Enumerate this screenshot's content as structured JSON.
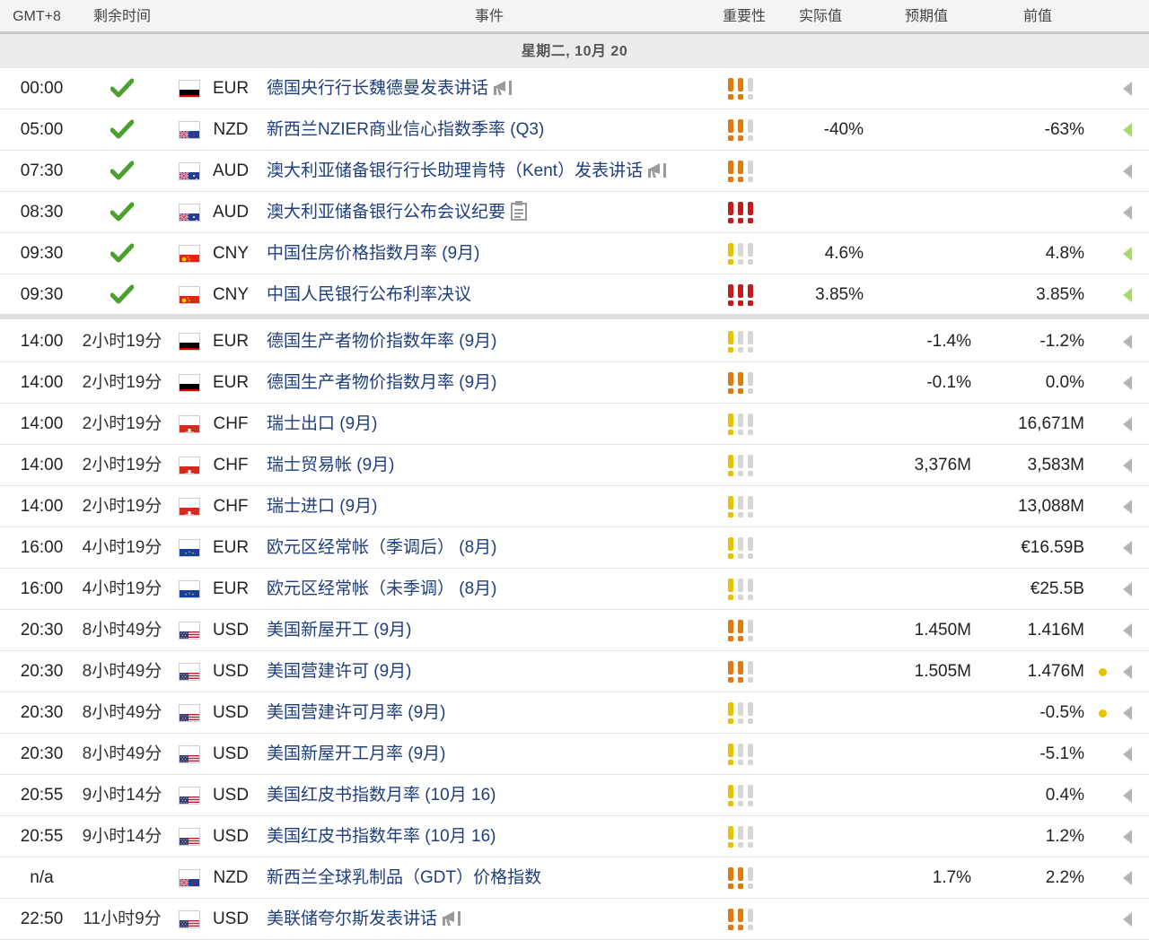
{
  "header": {
    "timezone": "GMT+8",
    "remaining": "剩余时间",
    "event": "事件",
    "importance": "重要性",
    "actual": "实际值",
    "forecast": "预期值",
    "previous": "前值"
  },
  "day_label": "星期二, 10月 20",
  "colors": {
    "check": "#4ca02f",
    "imp_orange": "#e07a10",
    "imp_red": "#c41c1c",
    "imp_yellow": "#e6c200",
    "imp_off": "#d6d6d6",
    "arrow_grey": "#b5b5b5",
    "arrow_green": "#a8d873",
    "event_text": "#1f3e7c"
  },
  "rows": [
    {
      "time": "00:00",
      "remaining": "",
      "done": true,
      "flag": "de",
      "currency": "EUR",
      "event": "德国央行行长魏德曼发表讲话",
      "icon": "speech-icon",
      "importance": 2,
      "actual": "",
      "forecast": "",
      "previous": "",
      "dot": false,
      "arrow": "grey"
    },
    {
      "time": "05:00",
      "remaining": "",
      "done": true,
      "flag": "nz",
      "currency": "NZD",
      "event": "新西兰NZIER商业信心指数季率 (Q3)",
      "icon": "",
      "importance": 2,
      "actual": "-40%",
      "forecast": "",
      "previous": "-63%",
      "dot": false,
      "arrow": "green"
    },
    {
      "time": "07:30",
      "remaining": "",
      "done": true,
      "flag": "au",
      "currency": "AUD",
      "event": "澳大利亚储备银行行长助理肯特（Kent）发表讲话",
      "icon": "speech-icon",
      "importance": 2,
      "actual": "",
      "forecast": "",
      "previous": "",
      "dot": false,
      "arrow": "grey"
    },
    {
      "time": "08:30",
      "remaining": "",
      "done": true,
      "flag": "au",
      "currency": "AUD",
      "event": "澳大利亚储备银行公布会议纪要",
      "icon": "report-icon",
      "importance": 3,
      "actual": "",
      "forecast": "",
      "previous": "",
      "dot": false,
      "arrow": "grey"
    },
    {
      "time": "09:30",
      "remaining": "",
      "done": true,
      "flag": "cn",
      "currency": "CNY",
      "event": "中国住房价格指数月率 (9月)",
      "icon": "",
      "importance": 1,
      "actual": "4.6%",
      "forecast": "",
      "previous": "4.8%",
      "dot": false,
      "arrow": "green"
    },
    {
      "time": "09:30",
      "remaining": "",
      "done": true,
      "flag": "cn",
      "currency": "CNY",
      "event": "中国人民银行公布利率决议",
      "icon": "",
      "importance": 3,
      "actual": "3.85%",
      "forecast": "",
      "previous": "3.85%",
      "dot": false,
      "arrow": "green"
    },
    {
      "time": "14:00",
      "remaining": "2小时19分",
      "done": false,
      "flag": "de",
      "currency": "EUR",
      "event": "德国生产者物价指数年率 (9月)",
      "icon": "",
      "importance": 1,
      "actual": "",
      "forecast": "-1.4%",
      "previous": "-1.2%",
      "dot": false,
      "arrow": "grey"
    },
    {
      "time": "14:00",
      "remaining": "2小时19分",
      "done": false,
      "flag": "de",
      "currency": "EUR",
      "event": "德国生产者物价指数月率 (9月)",
      "icon": "",
      "importance": 2,
      "actual": "",
      "forecast": "-0.1%",
      "previous": "0.0%",
      "dot": false,
      "arrow": "grey"
    },
    {
      "time": "14:00",
      "remaining": "2小时19分",
      "done": false,
      "flag": "ch",
      "currency": "CHF",
      "event": "瑞士出口 (9月)",
      "icon": "",
      "importance": 1,
      "actual": "",
      "forecast": "",
      "previous": "16,671M",
      "dot": false,
      "arrow": "grey"
    },
    {
      "time": "14:00",
      "remaining": "2小时19分",
      "done": false,
      "flag": "ch",
      "currency": "CHF",
      "event": "瑞士贸易帐 (9月)",
      "icon": "",
      "importance": 1,
      "actual": "",
      "forecast": "3,376M",
      "previous": "3,583M",
      "dot": false,
      "arrow": "grey"
    },
    {
      "time": "14:00",
      "remaining": "2小时19分",
      "done": false,
      "flag": "ch",
      "currency": "CHF",
      "event": "瑞士进口 (9月)",
      "icon": "",
      "importance": 1,
      "actual": "",
      "forecast": "",
      "previous": "13,088M",
      "dot": false,
      "arrow": "grey"
    },
    {
      "time": "16:00",
      "remaining": "4小时19分",
      "done": false,
      "flag": "eu",
      "currency": "EUR",
      "event": "欧元区经常帐（季调后） (8月)",
      "icon": "",
      "importance": 1,
      "actual": "",
      "forecast": "",
      "previous": "€16.59B",
      "dot": false,
      "arrow": "grey"
    },
    {
      "time": "16:00",
      "remaining": "4小时19分",
      "done": false,
      "flag": "eu",
      "currency": "EUR",
      "event": "欧元区经常帐（未季调） (8月)",
      "icon": "",
      "importance": 1,
      "actual": "",
      "forecast": "",
      "previous": "€25.5B",
      "dot": false,
      "arrow": "grey"
    },
    {
      "time": "20:30",
      "remaining": "8小时49分",
      "done": false,
      "flag": "us",
      "currency": "USD",
      "event": "美国新屋开工 (9月)",
      "icon": "",
      "importance": 2,
      "actual": "",
      "forecast": "1.450M",
      "previous": "1.416M",
      "dot": false,
      "arrow": "grey"
    },
    {
      "time": "20:30",
      "remaining": "8小时49分",
      "done": false,
      "flag": "us",
      "currency": "USD",
      "event": "美国营建许可 (9月)",
      "icon": "",
      "importance": 2,
      "actual": "",
      "forecast": "1.505M",
      "previous": "1.476M",
      "dot": true,
      "arrow": "grey"
    },
    {
      "time": "20:30",
      "remaining": "8小时49分",
      "done": false,
      "flag": "us",
      "currency": "USD",
      "event": "美国营建许可月率 (9月)",
      "icon": "",
      "importance": 1,
      "actual": "",
      "forecast": "",
      "previous": "-0.5%",
      "dot": true,
      "arrow": "grey"
    },
    {
      "time": "20:30",
      "remaining": "8小时49分",
      "done": false,
      "flag": "us",
      "currency": "USD",
      "event": "美国新屋开工月率 (9月)",
      "icon": "",
      "importance": 1,
      "actual": "",
      "forecast": "",
      "previous": "-5.1%",
      "dot": false,
      "arrow": "grey"
    },
    {
      "time": "20:55",
      "remaining": "9小时14分",
      "done": false,
      "flag": "us",
      "currency": "USD",
      "event": "美国红皮书指数月率 (10月 16)",
      "icon": "",
      "importance": 1,
      "actual": "",
      "forecast": "",
      "previous": "0.4%",
      "dot": false,
      "arrow": "grey"
    },
    {
      "time": "20:55",
      "remaining": "9小时14分",
      "done": false,
      "flag": "us",
      "currency": "USD",
      "event": "美国红皮书指数年率 (10月 16)",
      "icon": "",
      "importance": 1,
      "actual": "",
      "forecast": "",
      "previous": "1.2%",
      "dot": false,
      "arrow": "grey"
    },
    {
      "time": "n/a",
      "remaining": "",
      "done": false,
      "flag": "nz",
      "currency": "NZD",
      "event": "新西兰全球乳制品（GDT）价格指数",
      "icon": "",
      "importance": 2,
      "actual": "",
      "forecast": "1.7%",
      "previous": "2.2%",
      "dot": false,
      "arrow": "grey"
    },
    {
      "time": "22:50",
      "remaining": "11小时9分",
      "done": false,
      "flag": "us",
      "currency": "USD",
      "event": "美联储夸尔斯发表讲话",
      "icon": "speech-icon",
      "importance": 2,
      "actual": "",
      "forecast": "",
      "previous": "",
      "dot": false,
      "arrow": "grey"
    }
  ]
}
